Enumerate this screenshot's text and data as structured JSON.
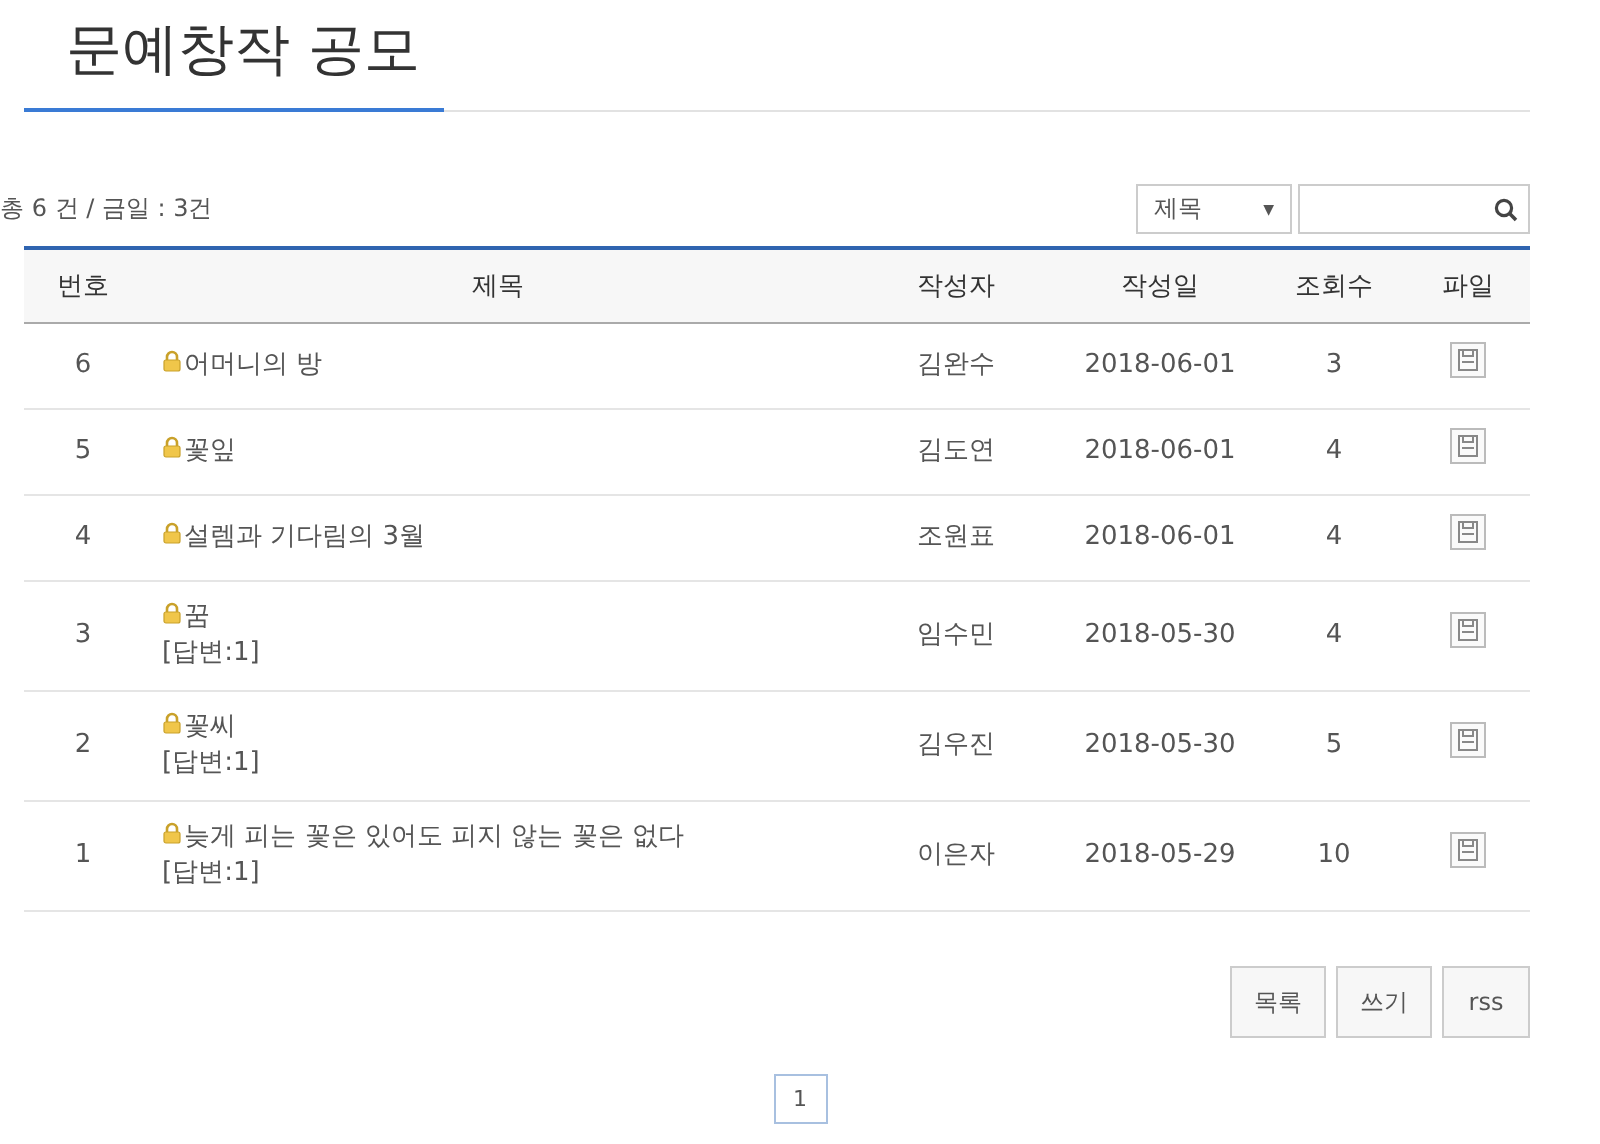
{
  "page_title": "문예창작 공모",
  "summary": "총 6 건 / 금일 : 3건",
  "search": {
    "field": "제목",
    "caret": "▼"
  },
  "table": {
    "columns": [
      "번호",
      "제목",
      "작성자",
      "작성일",
      "조회수",
      "파일"
    ],
    "rows": [
      {
        "number": "6",
        "title": "어머니의 방",
        "locked": true,
        "author": "김완수",
        "date": "2018-06-01",
        "views": "3",
        "has_file": true
      },
      {
        "number": "5",
        "title": "꽃잎",
        "locked": true,
        "author": "김도연",
        "date": "2018-06-01",
        "views": "4",
        "has_file": true
      },
      {
        "number": "4",
        "title": "설렘과 기다림의 3월",
        "locked": true,
        "author": "조원표",
        "date": "2018-06-01",
        "views": "4",
        "has_file": true
      },
      {
        "number": "3",
        "title": "꿈",
        "reply": "[답변:1]",
        "locked": true,
        "author": "임수민",
        "date": "2018-05-30",
        "views": "4",
        "has_file": true
      },
      {
        "number": "2",
        "title": "꽃씨",
        "reply": "[답변:1]",
        "locked": true,
        "author": "김우진",
        "date": "2018-05-30",
        "views": "5",
        "has_file": true
      },
      {
        "number": "1",
        "title": "늦게 피는 꽃은 있어도 피지 않는 꽃은 없다",
        "reply": "[답변:1]",
        "locked": true,
        "author": "이은자",
        "date": "2018-05-29",
        "views": "10",
        "has_file": true
      }
    ]
  },
  "buttons": [
    "목록",
    "쓰기",
    "rss"
  ],
  "pagination": [
    {
      "label": "1",
      "selected": true
    }
  ]
}
